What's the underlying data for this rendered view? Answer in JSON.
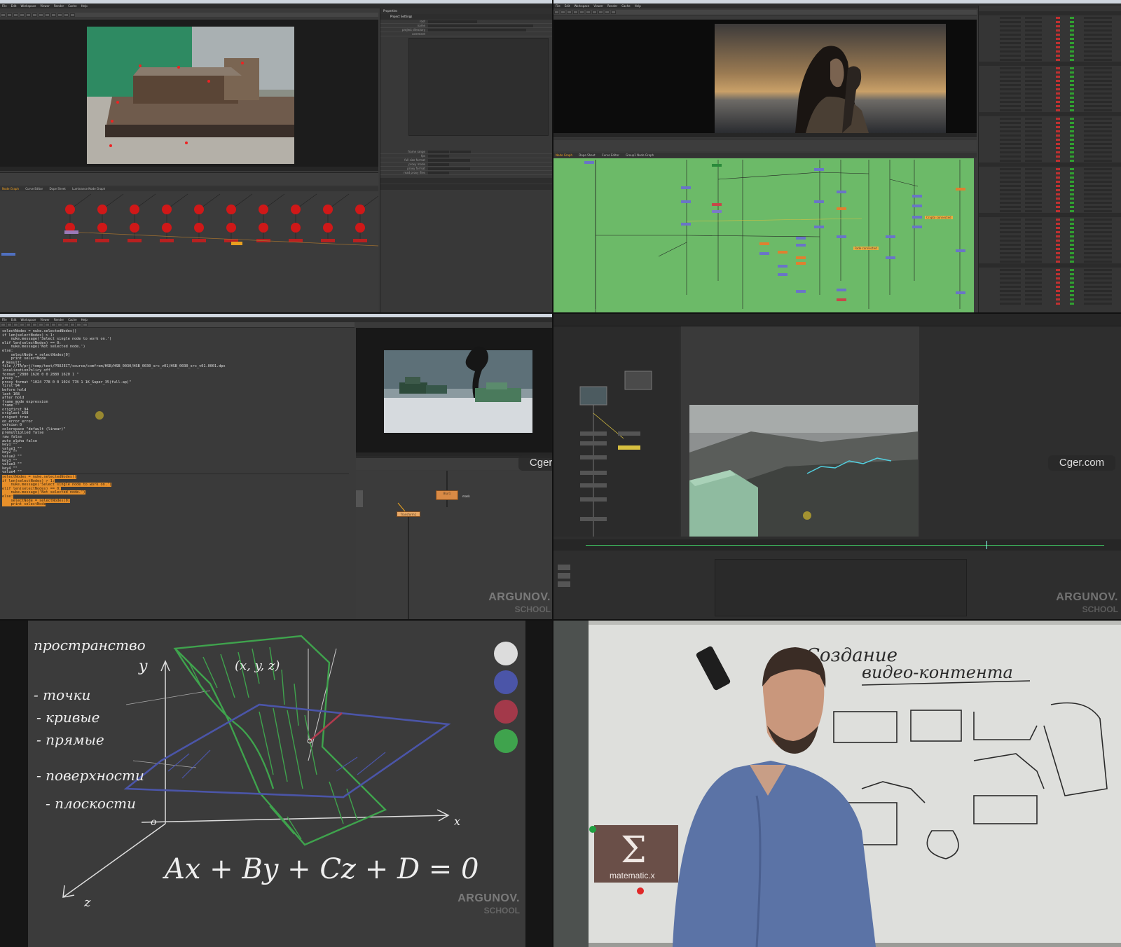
{
  "watermarks": {
    "school_top": "ARGUNOV.",
    "school_bottom": "SCHOOL",
    "cger": "Cger.com"
  },
  "colors": {
    "nuke_bg": "#3a3a3a",
    "node_graph_green": "#6cba68",
    "highlight_orange": "#e8902a",
    "node_red": "#d01818",
    "swatch_white": "#dcdcdc",
    "swatch_blue": "#4b55a8",
    "swatch_red": "#a3394a",
    "swatch_green": "#3fa34d"
  },
  "panel1": {
    "tabs": [
      "Node Graph",
      "Curve Editor",
      "Dope Sheet",
      "Luminance Node Graph"
    ],
    "properties_title": "Project Settings"
  },
  "panel2": {
    "tabs": [
      "Node Graph",
      "Dope Sheet",
      "Curve Editor",
      "Group1 Node Graph"
    ],
    "notes": [
      "Fade connected",
      "Crypto connected"
    ]
  },
  "panel3": {
    "script_lines": [
      "selectNodes = nuke.selectedNodes()",
      "if len(selectNodes) > 1:",
      "    nuke.message('Select single node to work on.')",
      "elif len(selectNodes) == 0:",
      "    nuke.message('Not selected node.')",
      "else:",
      "    selectNode = selectNodes[0]",
      "    print selectNode",
      "# Result:",
      "file //TA/prj/temp/test/PROJECT/source/comfrom/HSB/HSB_0030/HSB_0030_src_v01/HSB_0030_src_v01.0001.dpx",
      "localizationPolicy off",
      "format \"2880 1620 0 0 2880 1620 1 \"",
      "proxy \"\"",
      "proxy_format \"1024 778 0 0 1024 778 1 1K_Super_35(full-ap)\"",
      "first 94",
      "before hold",
      "last 168",
      "after hold",
      "frame_mode expression",
      "frame \"\"",
      "origfirst 94",
      "origlast 168",
      "origset true",
      "on_error error",
      "version 0",
      "colorspace \"default (linear)\"",
      "premultiplied false",
      "raw false",
      "auto_alpha false",
      "key1 \"\"",
      "value1 \"\"",
      "key2 \"\"",
      "value2 \"\"",
      "key3 \"\"",
      "value3 \"\"",
      "key4 \"\"",
      "value4 \"\""
    ],
    "editor_lines": [
      "selectNodes = nuke.selectedNodes()",
      "if len(selectNodes) > 1:",
      "    nuke.message('Select single node to work on.')",
      "elif len(selectNodes) == 0:",
      "    nuke.message('Not selected node.')",
      "else:",
      "    selectNode = selectNodes[0]",
      "    print selectNode"
    ],
    "nodes": [
      "Blur1",
      "Transform1"
    ],
    "mask_label": "mask"
  },
  "panel5": {
    "title": "пространство",
    "list": [
      "- точки",
      "- кривые",
      "- прямые",
      "- поверхности",
      "- плоскости"
    ],
    "point_label": "(x, y, z)",
    "axis_y": "y",
    "axis_x": "x",
    "axis_z": "z",
    "origin": "o",
    "equation": "Ax + By + Cz + D = 0"
  },
  "panel6": {
    "board_title_1": "Создание",
    "board_title_2": "видео-контента",
    "sign_symbol": "Σ",
    "sign_text": "matematic.x"
  }
}
